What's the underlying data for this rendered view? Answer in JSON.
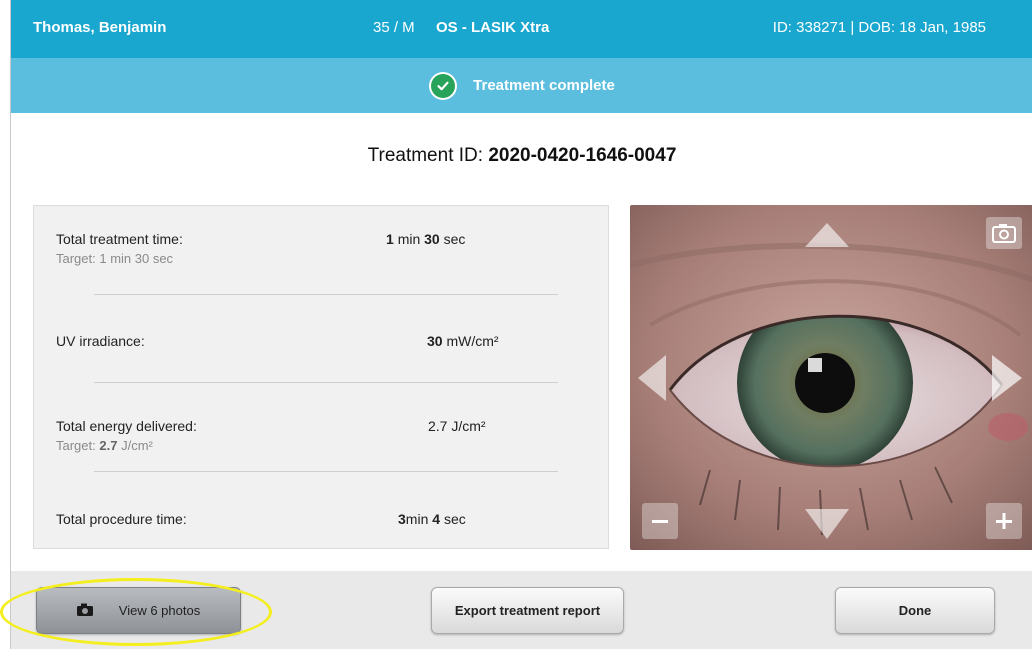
{
  "header": {
    "patient_name": "Thomas, Benjamin",
    "age_sex": "35 / M",
    "procedure": "OS - LASIK Xtra",
    "ids": "ID: 338271 | DOB: 18 Jan, 1985"
  },
  "status": {
    "text": "Treatment complete",
    "icon": "check-circle-icon"
  },
  "treatment": {
    "label": "Treatment ID:",
    "id": "2020-0420-1646-0047"
  },
  "metrics": {
    "treatment_time": {
      "label": "Total treatment time:",
      "target": "Target: 1 min 30 sec",
      "min": "1",
      "min_unit": "min",
      "sec": "30",
      "sec_unit": "sec"
    },
    "uv_irradiance": {
      "label": "UV irradiance:",
      "value": "30",
      "unit": "mW/cm²"
    },
    "energy": {
      "label": "Total energy delivered:",
      "target_prefix": "Target:",
      "target_value": "2.7",
      "target_unit": "J/cm²",
      "value": "2.7",
      "unit": "J/cm²"
    },
    "procedure_time": {
      "label": "Total procedure time:",
      "min": "3",
      "min_unit": "min",
      "sec": "4",
      "sec_unit": "sec"
    }
  },
  "camera": {
    "controls": {
      "up": "arrow-up-icon",
      "down": "arrow-down-icon",
      "left": "arrow-left-icon",
      "right": "arrow-right-icon",
      "zoom_out": "minus-icon",
      "zoom_in": "plus-icon",
      "capture": "camera-icon"
    }
  },
  "footer": {
    "view_photos": "View 6 photos",
    "export": "Export treatment report",
    "done": "Done"
  },
  "colors": {
    "header": "#1aa7cf",
    "status_bar": "#5bbede",
    "success": "#27a35a",
    "highlight": "#f5ee1f"
  }
}
